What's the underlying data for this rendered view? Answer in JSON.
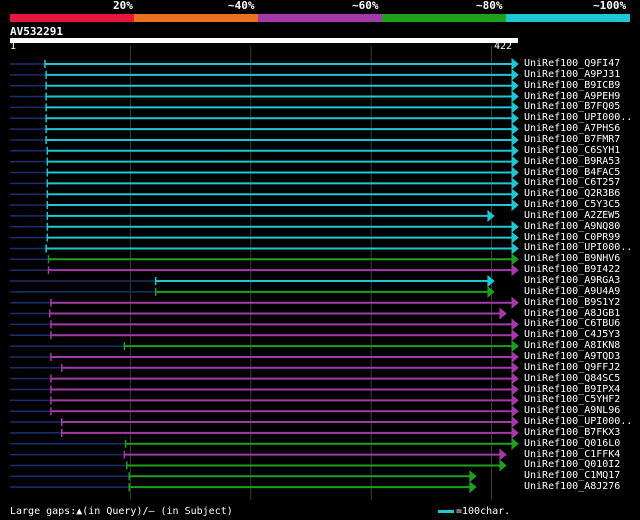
{
  "colors": {
    "background": "#000000",
    "identity_20": "#e8163c",
    "identity_40": "#e8701e",
    "identity_60": "#a43aa8",
    "identity_80": "#1ea01e",
    "identity_100": "#1ec8d2",
    "subject_line": "#1c2e6e",
    "gridline": "#3a3a3a",
    "query_bar": "#ffffff",
    "insert_marker": "#ffffa0"
  },
  "scale": {
    "labels": [
      "20%",
      "~40%",
      "~60%",
      "~80%",
      "~100%"
    ]
  },
  "query": {
    "id": "AV532291",
    "start": "1",
    "end": "422"
  },
  "legend": {
    "gaps_text": "Large gaps:▲(in Query)/— (in Subject)",
    "scale_text": "=100char."
  },
  "hits": [
    {
      "name": "UniRef100_Q9FI47",
      "identity": "100",
      "q_start": 29,
      "q_end": 422,
      "tail": "arrow"
    },
    {
      "name": "UniRef100_A9PJ31",
      "identity": "100",
      "q_start": 30,
      "q_end": 422,
      "tail": "arrow"
    },
    {
      "name": "UniRef100_B9ICB9",
      "identity": "100",
      "q_start": 30,
      "q_end": 422,
      "tail": "arrow"
    },
    {
      "name": "UniRef100_A9PEH9",
      "identity": "100",
      "q_start": 30,
      "q_end": 422,
      "tail": "arrow"
    },
    {
      "name": "UniRef100_B7FQ05",
      "identity": "100",
      "q_start": 30,
      "q_end": 422,
      "tail": "arrow"
    },
    {
      "name": "UniRef100_UPI000..",
      "identity": "100",
      "q_start": 30,
      "q_end": 422,
      "tail": "arrow"
    },
    {
      "name": "UniRef100_A7PHS6",
      "identity": "100",
      "q_start": 30,
      "q_end": 422,
      "tail": "arrow"
    },
    {
      "name": "UniRef100_B7FMR7",
      "identity": "100",
      "q_start": 30,
      "q_end": 422,
      "tail": "arrow"
    },
    {
      "name": "UniRef100_C6SYH1",
      "identity": "100",
      "q_start": 31,
      "q_end": 422,
      "tail": "arrow"
    },
    {
      "name": "UniRef100_B9RA53",
      "identity": "100",
      "q_start": 31,
      "q_end": 422,
      "tail": "arrow"
    },
    {
      "name": "UniRef100_B4FAC5",
      "identity": "100",
      "q_start": 31,
      "q_end": 422,
      "tail": "arrow"
    },
    {
      "name": "UniRef100_C6T257",
      "identity": "100",
      "q_start": 31,
      "q_end": 422,
      "tail": "bar"
    },
    {
      "name": "UniRef100_Q2R3B6",
      "identity": "100",
      "q_start": 31,
      "q_end": 422,
      "tail": "bar"
    },
    {
      "name": "UniRef100_C5Y3C5",
      "identity": "100",
      "q_start": 31,
      "q_end": 422,
      "tail": "bar"
    },
    {
      "name": "UniRef100_A2ZEW5",
      "identity": "100",
      "q_start": 31,
      "q_end": 402,
      "tail": "arrow"
    },
    {
      "name": "UniRef100_A9NQ80",
      "identity": "100",
      "q_start": 31,
      "q_end": 422,
      "tail": "arrow"
    },
    {
      "name": "UniRef100_C0PR99",
      "identity": "100",
      "q_start": 31,
      "q_end": 422,
      "tail": "arrow"
    },
    {
      "name": "UniRef100_UPI000..",
      "identity": "100",
      "q_start": 30,
      "q_end": 422,
      "tail": "arrow"
    },
    {
      "name": "UniRef100_B9NHV6",
      "identity": "80",
      "q_start": 32,
      "q_end": 422,
      "tail": "arrow"
    },
    {
      "name": "UniRef100_B9I422",
      "identity": "60",
      "q_start": 32,
      "q_end": 422,
      "tail": "arrow"
    },
    {
      "name": "UniRef100_A9RGA3",
      "identity": "100",
      "q_start": 121,
      "q_end": 402,
      "tail": "arrow"
    },
    {
      "name": "UniRef100_A9U4A9",
      "identity": "80",
      "q_start": 121,
      "q_end": 402,
      "tail": "arrow"
    },
    {
      "name": "UniRef100_B9S1Y2",
      "identity": "60",
      "q_start": 34,
      "q_end": 422,
      "tail": "arrow"
    },
    {
      "name": "UniRef100_A8JGB1",
      "identity": "60",
      "q_start": 33,
      "q_end": 412,
      "tail": "arrow"
    },
    {
      "name": "UniRef100_C6TBU6",
      "identity": "60",
      "q_start": 34,
      "q_end": 422,
      "tail": "arrow"
    },
    {
      "name": "UniRef100_C4J5Y3",
      "identity": "60",
      "q_start": 34,
      "q_end": 422,
      "tail": "arrow"
    },
    {
      "name": "UniRef100_A8IKN8",
      "identity": "80",
      "q_start": 95,
      "q_end": 422,
      "tail": "arrow"
    },
    {
      "name": "UniRef100_A9TQD3",
      "identity": "60",
      "q_start": 34,
      "q_end": 422,
      "tail": "arrow"
    },
    {
      "name": "UniRef100_Q9FFJ2",
      "identity": "60",
      "q_start": 43,
      "q_end": 422,
      "tail": "arrow"
    },
    {
      "name": "UniRef100_Q84SC5",
      "identity": "60",
      "q_start": 34,
      "q_end": 422,
      "tail": "arrow"
    },
    {
      "name": "UniRef100_B9IPX4",
      "identity": "60",
      "q_start": 34,
      "q_end": 422,
      "tail": "arrow"
    },
    {
      "name": "UniRef100_C5YHF2",
      "identity": "60",
      "q_start": 34,
      "q_end": 422,
      "tail": "arrow"
    },
    {
      "name": "UniRef100_A9NL96",
      "identity": "60",
      "q_start": 34,
      "q_end": 422,
      "tail": "arrow"
    },
    {
      "name": "UniRef100_UPI000..",
      "identity": "60",
      "q_start": 43,
      "q_end": 422,
      "tail": "arrow"
    },
    {
      "name": "UniRef100_B7FKX3",
      "identity": "60",
      "q_start": 43,
      "q_end": 422,
      "tail": "arrow"
    },
    {
      "name": "UniRef100_Q016L0",
      "identity": "80",
      "q_start": 96,
      "q_end": 422,
      "tail": "arrow"
    },
    {
      "name": "UniRef100_C1FFK4",
      "identity": "60",
      "q_start": 95,
      "q_end": 412,
      "tail": "arrow"
    },
    {
      "name": "UniRef100_Q010I2",
      "identity": "80",
      "q_start": 97,
      "q_end": 412,
      "tail": "arrow"
    },
    {
      "name": "UniRef100_C1MQ17",
      "identity": "80",
      "q_start": 99,
      "q_end": 387,
      "tail": "arrow"
    },
    {
      "name": "UniRef100_A8J276",
      "identity": "80",
      "q_start": 99,
      "q_end": 387,
      "tail": "arrow"
    }
  ]
}
